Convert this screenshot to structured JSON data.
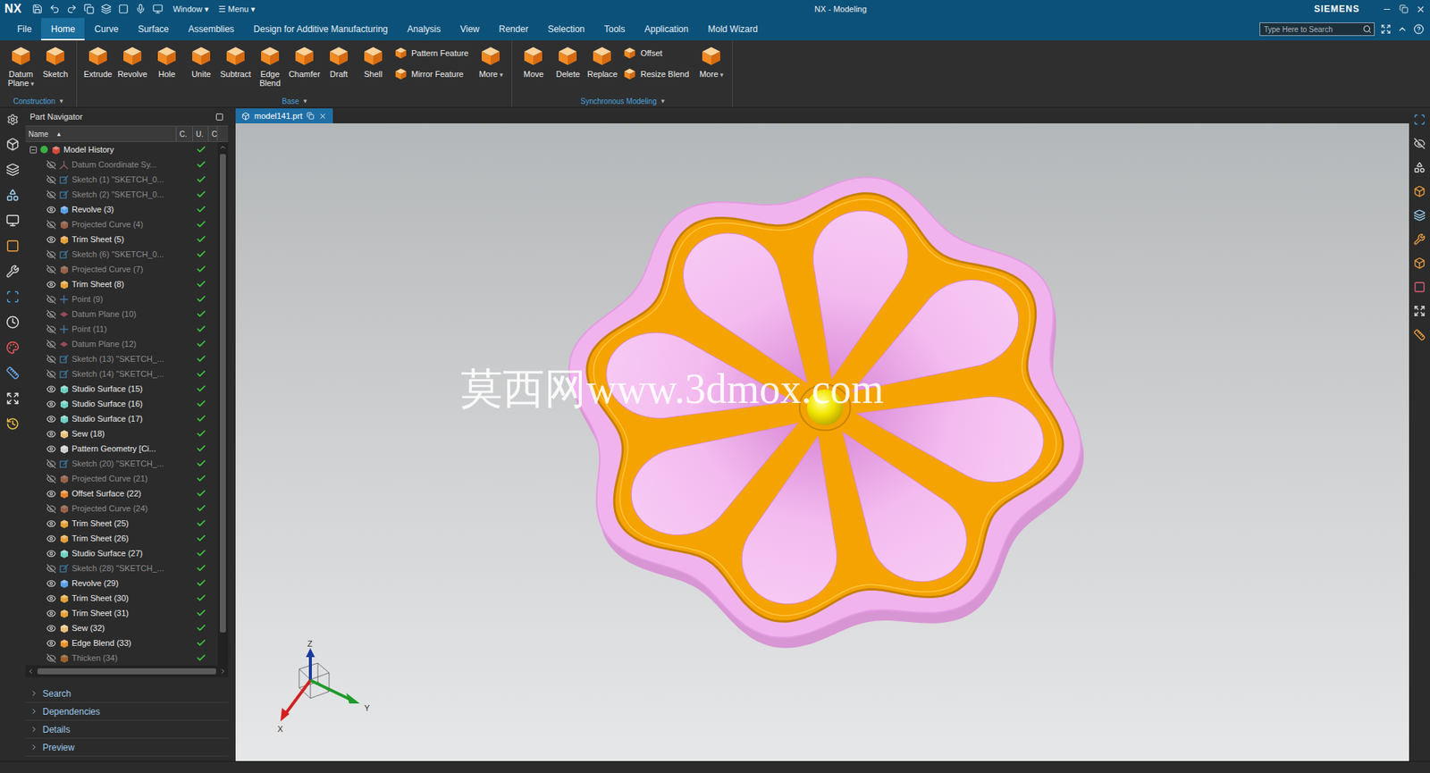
{
  "window": {
    "logo": "NX",
    "title": "NX - Modeling",
    "brand": "SIEMENS"
  },
  "quick_access": [
    "Window ▾",
    "☰ Menu ▾"
  ],
  "search": {
    "placeholder": "Type Here to Search"
  },
  "menu_tabs": [
    {
      "label": "File",
      "selected": false
    },
    {
      "label": "Home",
      "selected": true
    },
    {
      "label": "Curve",
      "selected": false
    },
    {
      "label": "Surface",
      "selected": false
    },
    {
      "label": "Assemblies",
      "selected": false
    },
    {
      "label": "Design for Additive Manufacturing",
      "selected": false
    },
    {
      "label": "Analysis",
      "selected": false
    },
    {
      "label": "View",
      "selected": false
    },
    {
      "label": "Render",
      "selected": false
    },
    {
      "label": "Selection",
      "selected": false
    },
    {
      "label": "Tools",
      "selected": false
    },
    {
      "label": "Application",
      "selected": false
    },
    {
      "label": "Mold Wizard",
      "selected": false
    }
  ],
  "ribbon": [
    {
      "label": "Construction",
      "caret": "▾",
      "items": [
        {
          "kind": "large",
          "label": "Datum Plane",
          "caret": "▾"
        },
        {
          "kind": "large",
          "label": "Sketch",
          "caret": ""
        }
      ]
    },
    {
      "label": "Base",
      "caret": "▾",
      "items": [
        {
          "kind": "large",
          "label": "Extrude",
          "caret": ""
        },
        {
          "kind": "large",
          "label": "Revolve",
          "caret": ""
        },
        {
          "kind": "large",
          "label": "Hole",
          "caret": ""
        },
        {
          "kind": "large",
          "label": "Unite",
          "caret": ""
        },
        {
          "kind": "large",
          "label": "Subtract",
          "caret": ""
        },
        {
          "kind": "large",
          "label": "Edge Blend",
          "caret": ""
        },
        {
          "kind": "large",
          "label": "Chamfer",
          "caret": ""
        },
        {
          "kind": "large",
          "label": "Draft",
          "caret": ""
        },
        {
          "kind": "large",
          "label": "Shell",
          "caret": ""
        },
        {
          "kind": "stack",
          "items": [
            {
              "label": "Pattern Feature"
            },
            {
              "label": "Mirror Feature"
            }
          ]
        },
        {
          "kind": "large",
          "label": "More",
          "caret": "▾"
        }
      ]
    },
    {
      "label": "Synchronous Modeling",
      "caret": "▾",
      "items": [
        {
          "kind": "large",
          "label": "Move",
          "caret": ""
        },
        {
          "kind": "large",
          "label": "Delete",
          "caret": ""
        },
        {
          "kind": "large",
          "label": "Replace",
          "caret": ""
        },
        {
          "kind": "stack",
          "items": [
            {
              "label": "Offset"
            },
            {
              "label": "Resize Blend"
            }
          ]
        },
        {
          "kind": "large",
          "label": "More",
          "caret": "▾"
        }
      ]
    }
  ],
  "navigator": {
    "title": "Part Navigator",
    "columns": [
      {
        "label": "Name",
        "sort": "▲"
      },
      {
        "label": "C.",
        "sort": ""
      },
      {
        "label": "U.",
        "sort": ""
      },
      {
        "label": "C",
        "sort": ""
      }
    ],
    "rows": [
      {
        "label": "Model History",
        "level": 0,
        "kind": "history",
        "visible": true,
        "greyed": false,
        "checked": true,
        "expanded": true
      },
      {
        "label": "Datum Coordinate Sy...",
        "level": 1,
        "kind": "datum-csys",
        "visible": false,
        "greyed": true,
        "checked": true,
        "expanded": false
      },
      {
        "label": "Sketch (1) \"SKETCH_0...",
        "level": 1,
        "kind": "sketch",
        "visible": false,
        "greyed": true,
        "checked": true,
        "expanded": false
      },
      {
        "label": "Sketch (2) \"SKETCH_0...",
        "level": 1,
        "kind": "sketch",
        "visible": false,
        "greyed": true,
        "checked": true,
        "expanded": false
      },
      {
        "label": "Revolve (3)",
        "level": 1,
        "kind": "revolve",
        "visible": true,
        "greyed": false,
        "checked": true,
        "expanded": false
      },
      {
        "label": "Projected Curve (4)",
        "level": 1,
        "kind": "projected",
        "visible": false,
        "greyed": true,
        "checked": true,
        "expanded": false
      },
      {
        "label": "Trim Sheet (5)",
        "level": 1,
        "kind": "trim",
        "visible": true,
        "greyed": false,
        "checked": true,
        "expanded": false
      },
      {
        "label": "Sketch (6) \"SKETCH_0...",
        "level": 1,
        "kind": "sketch",
        "visible": false,
        "greyed": true,
        "checked": true,
        "expanded": false
      },
      {
        "label": "Projected Curve (7)",
        "level": 1,
        "kind": "projected",
        "visible": false,
        "greyed": true,
        "checked": true,
        "expanded": false
      },
      {
        "label": "Trim Sheet (8)",
        "level": 1,
        "kind": "trim",
        "visible": true,
        "greyed": false,
        "checked": true,
        "expanded": false
      },
      {
        "label": "Point (9)",
        "level": 1,
        "kind": "point",
        "visible": false,
        "greyed": true,
        "checked": true,
        "expanded": false
      },
      {
        "label": "Datum Plane (10)",
        "level": 1,
        "kind": "plane",
        "visible": false,
        "greyed": true,
        "checked": true,
        "expanded": false
      },
      {
        "label": "Point (11)",
        "level": 1,
        "kind": "point",
        "visible": false,
        "greyed": true,
        "checked": true,
        "expanded": false
      },
      {
        "label": "Datum Plane (12)",
        "level": 1,
        "kind": "plane",
        "visible": false,
        "greyed": true,
        "checked": true,
        "expanded": false
      },
      {
        "label": "Sketch (13) \"SKETCH_...",
        "level": 1,
        "kind": "sketch",
        "visible": false,
        "greyed": true,
        "checked": true,
        "expanded": false
      },
      {
        "label": "Sketch (14) \"SKETCH_...",
        "level": 1,
        "kind": "sketch",
        "visible": false,
        "greyed": true,
        "checked": true,
        "expanded": false
      },
      {
        "label": "Studio Surface (15)",
        "level": 1,
        "kind": "studio",
        "visible": true,
        "greyed": false,
        "checked": true,
        "expanded": false
      },
      {
        "label": "Studio Surface (16)",
        "level": 1,
        "kind": "studio",
        "visible": true,
        "greyed": false,
        "checked": true,
        "expanded": false
      },
      {
        "label": "Studio Surface (17)",
        "level": 1,
        "kind": "studio",
        "visible": true,
        "greyed": false,
        "checked": true,
        "expanded": false
      },
      {
        "label": "Sew (18)",
        "level": 1,
        "kind": "sew",
        "visible": true,
        "greyed": false,
        "checked": true,
        "expanded": false
      },
      {
        "label": "Pattern Geometry [Ci...",
        "level": 1,
        "kind": "pattern",
        "visible": true,
        "greyed": false,
        "checked": true,
        "expanded": false
      },
      {
        "label": "Sketch (20) \"SKETCH_...",
        "level": 1,
        "kind": "sketch",
        "visible": false,
        "greyed": true,
        "checked": true,
        "expanded": false
      },
      {
        "label": "Projected Curve (21)",
        "level": 1,
        "kind": "projected",
        "visible": false,
        "greyed": true,
        "checked": true,
        "expanded": false
      },
      {
        "label": "Offset Surface (22)",
        "level": 1,
        "kind": "offset",
        "visible": true,
        "greyed": false,
        "checked": true,
        "expanded": false
      },
      {
        "label": "Projected Curve (24)",
        "level": 1,
        "kind": "projected",
        "visible": false,
        "greyed": true,
        "checked": true,
        "expanded": false
      },
      {
        "label": "Trim Sheet (25)",
        "level": 1,
        "kind": "trim",
        "visible": true,
        "greyed": false,
        "checked": true,
        "expanded": false
      },
      {
        "label": "Trim Sheet (26)",
        "level": 1,
        "kind": "trim",
        "visible": true,
        "greyed": false,
        "checked": true,
        "expanded": false
      },
      {
        "label": "Studio Surface (27)",
        "level": 1,
        "kind": "studio",
        "visible": true,
        "greyed": false,
        "checked": true,
        "expanded": false
      },
      {
        "label": "Sketch (28) \"SKETCH_...",
        "level": 1,
        "kind": "sketch",
        "visible": false,
        "greyed": true,
        "checked": true,
        "expanded": false
      },
      {
        "label": "Revolve (29)",
        "level": 1,
        "kind": "revolve",
        "visible": true,
        "greyed": false,
        "checked": true,
        "expanded": false
      },
      {
        "label": "Trim Sheet (30)",
        "level": 1,
        "kind": "trim",
        "visible": true,
        "greyed": false,
        "checked": true,
        "expanded": false
      },
      {
        "label": "Trim Sheet (31)",
        "level": 1,
        "kind": "trim",
        "visible": true,
        "greyed": false,
        "checked": true,
        "expanded": false
      },
      {
        "label": "Sew (32)",
        "level": 1,
        "kind": "sew",
        "visible": true,
        "greyed": false,
        "checked": true,
        "expanded": false
      },
      {
        "label": "Edge Blend (33)",
        "level": 1,
        "kind": "blend",
        "visible": true,
        "greyed": false,
        "checked": true,
        "expanded": false
      },
      {
        "label": "Thicken (34)",
        "level": 1,
        "kind": "thicken",
        "visible": false,
        "greyed": true,
        "checked": true,
        "expanded": false
      }
    ],
    "sections": [
      {
        "label": "Search",
        "expanded": false
      },
      {
        "label": "Dependencies",
        "expanded": false
      },
      {
        "label": "Details",
        "expanded": false
      },
      {
        "label": "Preview",
        "expanded": false
      }
    ]
  },
  "graphics": {
    "file_tab": {
      "label": "model141.prt",
      "selected": true
    },
    "watermark": "莫西网www.3dmox.com",
    "axes": {
      "x": "X",
      "y": "Y",
      "z": "Z"
    }
  }
}
